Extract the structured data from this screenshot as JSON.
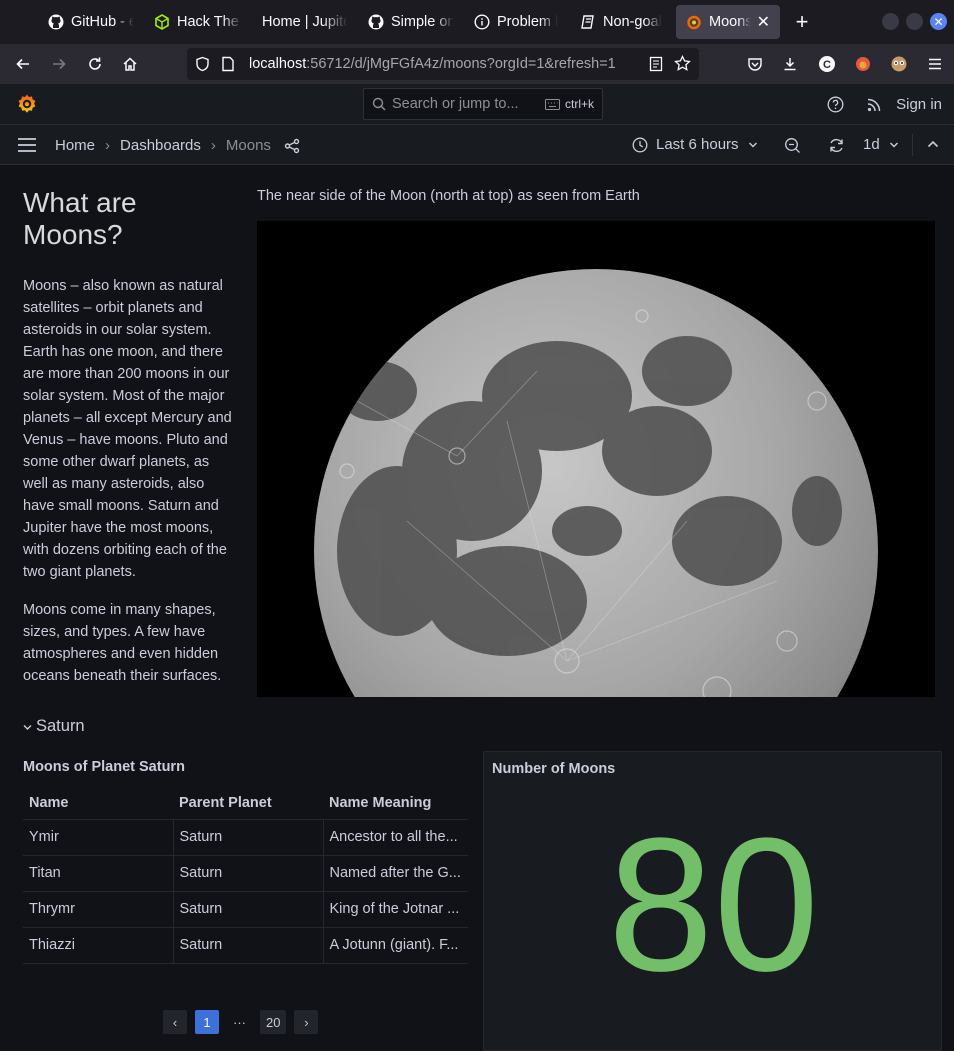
{
  "browser": {
    "tabs": [
      {
        "label": "GitHub - e",
        "icon": "github-icon"
      },
      {
        "label": "Hack The B",
        "icon": "hackthebox-icon"
      },
      {
        "label": "Home | Jupite",
        "icon": "jupyter-icon"
      },
      {
        "label": "Simple on",
        "icon": "github-icon"
      },
      {
        "label": "Problem l",
        "icon": "info-icon"
      },
      {
        "label": "Non-goal",
        "icon": "notebook-icon"
      },
      {
        "label": "Moons",
        "icon": "grafana-icon",
        "active": true
      }
    ],
    "url_host": "localhost",
    "url_path": ":56712/d/jMgFGfA4z/moons?orgId=1&refresh=1"
  },
  "grafana": {
    "search_placeholder": "Search or jump to...",
    "search_shortcut": "ctrl+k",
    "signin_label": "Sign in",
    "breadcrumbs": [
      "Home",
      "Dashboards",
      "Moons"
    ],
    "time_range": "Last 6 hours",
    "refresh_interval": "1d"
  },
  "text_panel": {
    "title": "What are Moons?",
    "para1": "Moons – also known as natural satellites – orbit planets and asteroids in our solar system. Earth has one moon, and there are more than 200 moons in our solar system. Most of the major planets – all except Mercury and Venus – have moons. Pluto and some other dwarf planets, as well as many asteroids, also have small moons. Saturn and Jupiter have the most moons, with dozens orbiting each of the two giant planets.",
    "para2": "Moons come in many shapes, sizes, and types. A few have atmospheres and even hidden oceans beneath their surfaces."
  },
  "image_panel": {
    "title": "The near side of the Moon (north at top) as seen from Earth"
  },
  "row": {
    "title": "Saturn"
  },
  "table_panel": {
    "title": "Moons of Planet Saturn",
    "columns": [
      "Name",
      "Parent Planet",
      "Name Meaning"
    ],
    "rows": [
      [
        "Ymir",
        "Saturn",
        "Ancestor to all the..."
      ],
      [
        "Titan",
        "Saturn",
        "Named after the G..."
      ],
      [
        "Thrymr",
        "Saturn",
        "King of the Jotnar ..."
      ],
      [
        "Thiazzi",
        "Saturn",
        "A Jotunn (giant). F..."
      ]
    ],
    "pager": {
      "current": "1",
      "ellipsis": "···",
      "last": "20"
    }
  },
  "stat_panel": {
    "title": "Number of Moons",
    "value": "80",
    "color": "#73bf69"
  }
}
